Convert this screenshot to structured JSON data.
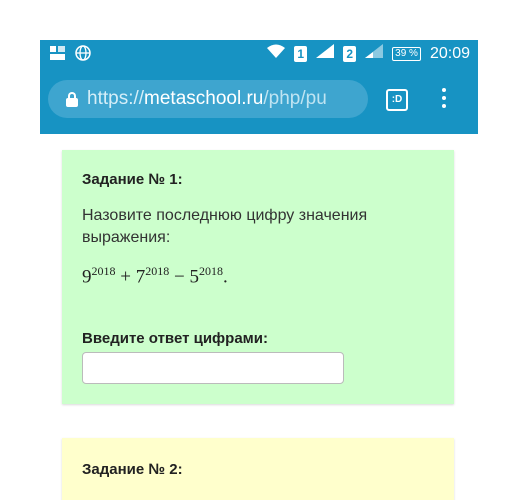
{
  "status_bar": {
    "sim1": "1",
    "sim2": "2",
    "battery": "39 %",
    "time": "20:09",
    "icons": [
      "notification-icon",
      "globe-icon",
      "wifi-icon",
      "signal-icon",
      "battery-icon"
    ]
  },
  "browser": {
    "url_scheme": "https://",
    "url_host": "metaschool.ru",
    "url_path": "/php/pu",
    "tab_label": ":D"
  },
  "task1": {
    "title": "Задание № 1:",
    "question": "Назовите последнюю цифру значения выражения:",
    "formula": {
      "base1": "9",
      "exp1": "2018",
      "op1": "+",
      "base2": "7",
      "exp2": "2018",
      "op2": "−",
      "base3": "5",
      "exp3": "2018",
      "end": "."
    },
    "answer_label": "Введите ответ цифрами:",
    "answer_value": ""
  },
  "task2": {
    "title": "Задание № 2:"
  },
  "colors": {
    "accent": "#1793c3",
    "card1_bg": "#ccffcc",
    "card2_bg": "#ffffcc"
  }
}
